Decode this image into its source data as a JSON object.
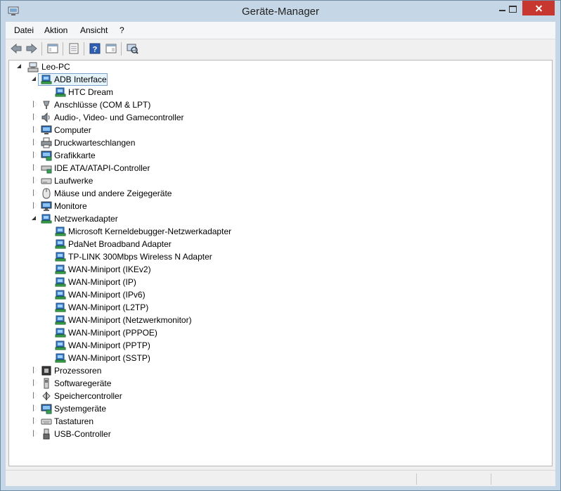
{
  "window": {
    "title": "Geräte-Manager"
  },
  "menu": [
    "Datei",
    "Aktion",
    "Ansicht",
    "?"
  ],
  "toolbar": {
    "buttons": [
      "back-icon",
      "forward-icon",
      "show-hide-console-tree-icon",
      "properties-icon",
      "help-icon",
      "view-icon",
      "scan-hardware-icon"
    ]
  },
  "tree": {
    "root": "Leo-PC",
    "rows": [
      {
        "label": "ADB Interface",
        "level": 1,
        "expanded": true,
        "icon": "network-adapter-icon",
        "selected": true
      },
      {
        "label": "HTC Dream",
        "level": 2,
        "icon": "network-adapter-icon"
      },
      {
        "label": "Anschlüsse (COM & LPT)",
        "level": 1,
        "expanded": false,
        "icon": "ports-icon"
      },
      {
        "label": "Audio-, Video- und Gamecontroller",
        "level": 1,
        "expanded": false,
        "icon": "audio-icon"
      },
      {
        "label": "Computer",
        "level": 1,
        "expanded": false,
        "icon": "computer-icon"
      },
      {
        "label": "Druckwarteschlangen",
        "level": 1,
        "expanded": false,
        "icon": "printer-icon"
      },
      {
        "label": "Grafikkarte",
        "level": 1,
        "expanded": false,
        "icon": "display-adapter-icon"
      },
      {
        "label": "IDE ATA/ATAPI-Controller",
        "level": 1,
        "expanded": false,
        "icon": "ide-controller-icon"
      },
      {
        "label": "Laufwerke",
        "level": 1,
        "expanded": false,
        "icon": "disk-drive-icon"
      },
      {
        "label": "Mäuse und andere Zeigegeräte",
        "level": 1,
        "expanded": false,
        "icon": "mouse-icon"
      },
      {
        "label": "Monitore",
        "level": 1,
        "expanded": false,
        "icon": "monitor-icon"
      },
      {
        "label": "Netzwerkadapter",
        "level": 1,
        "expanded": true,
        "icon": "network-adapter-icon"
      },
      {
        "label": "Microsoft Kerneldebugger-Netzwerkadapter",
        "level": 2,
        "icon": "network-adapter-icon"
      },
      {
        "label": "PdaNet Broadband Adapter",
        "level": 2,
        "icon": "network-adapter-icon"
      },
      {
        "label": "TP-LINK 300Mbps Wireless N Adapter",
        "level": 2,
        "icon": "network-adapter-icon"
      },
      {
        "label": "WAN-Miniport (IKEv2)",
        "level": 2,
        "icon": "network-adapter-icon"
      },
      {
        "label": "WAN-Miniport (IP)",
        "level": 2,
        "icon": "network-adapter-icon"
      },
      {
        "label": "WAN-Miniport (IPv6)",
        "level": 2,
        "icon": "network-adapter-icon"
      },
      {
        "label": "WAN-Miniport (L2TP)",
        "level": 2,
        "icon": "network-adapter-icon"
      },
      {
        "label": "WAN-Miniport (Netzwerkmonitor)",
        "level": 2,
        "icon": "network-adapter-icon"
      },
      {
        "label": "WAN-Miniport (PPPOE)",
        "level": 2,
        "icon": "network-adapter-icon"
      },
      {
        "label": "WAN-Miniport (PPTP)",
        "level": 2,
        "icon": "network-adapter-icon"
      },
      {
        "label": "WAN-Miniport (SSTP)",
        "level": 2,
        "icon": "network-adapter-icon"
      },
      {
        "label": "Prozessoren",
        "level": 1,
        "expanded": false,
        "icon": "processor-icon"
      },
      {
        "label": "Softwaregeräte",
        "level": 1,
        "expanded": false,
        "icon": "software-device-icon"
      },
      {
        "label": "Speichercontroller",
        "level": 1,
        "expanded": false,
        "icon": "storage-controller-icon"
      },
      {
        "label": "Systemgeräte",
        "level": 1,
        "expanded": false,
        "icon": "system-devices-icon"
      },
      {
        "label": "Tastaturen",
        "level": 1,
        "expanded": false,
        "icon": "keyboard-icon"
      },
      {
        "label": "USB-Controller",
        "level": 1,
        "expanded": false,
        "icon": "usb-icon"
      }
    ]
  },
  "colors": {
    "selection_bg": "#e5f3fb",
    "selection_border": "#7da2ce",
    "close_button": "#c7372f"
  }
}
